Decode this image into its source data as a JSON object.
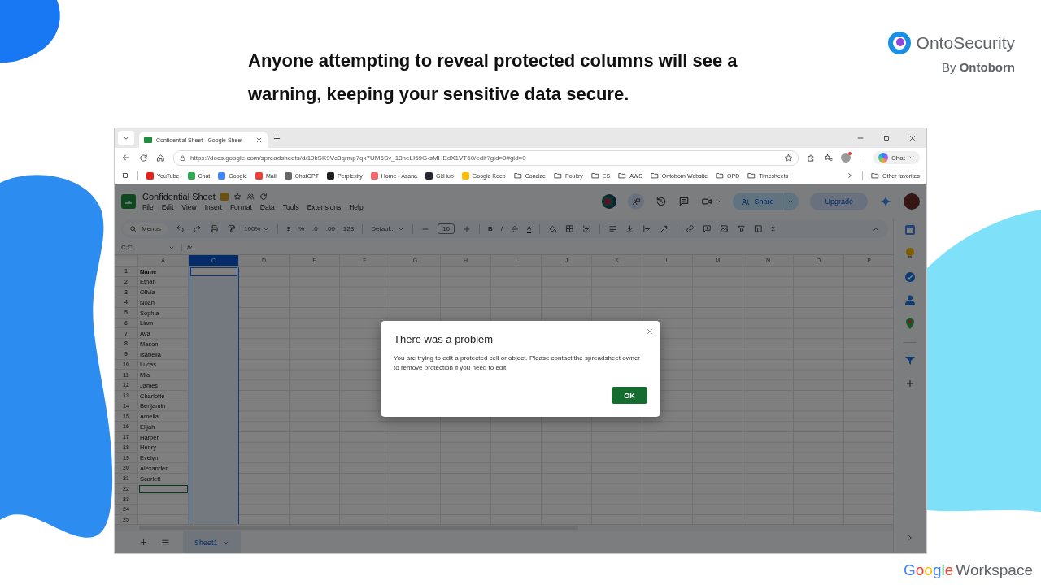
{
  "slide": {
    "heading": "Anyone attempting to reveal protected columns will see a warning, **keeping your sensitive data secure**.",
    "brand": {
      "name": "OntoSecurity",
      "byline": "By **Ontoborn**"
    },
    "footer_logo": {
      "google": "Google",
      "product": "Workspace"
    }
  },
  "browser": {
    "tabs": [
      {
        "title": "Confidential Sheet - Google Sheet",
        "selected": true
      }
    ],
    "url": "https://docs.google.com/spreadsheets/d/19kSK9Vc3qrmp7qk7UM6Sv_13heLI69G-sMHEdX1VT60/edit?gid=0#gid=0",
    "more": "···",
    "chat_button": "Chat",
    "bookmarks": [
      {
        "kind": "site",
        "label": "YouTube",
        "color": "#e62117"
      },
      {
        "kind": "site",
        "label": "Chat",
        "color": "#34a853"
      },
      {
        "kind": "site",
        "label": "Google",
        "color": "#4285f4"
      },
      {
        "kind": "site",
        "label": "Mail",
        "color": "#ea4335"
      },
      {
        "kind": "site",
        "label": "ChatGPT",
        "color": "#666666"
      },
      {
        "kind": "site",
        "label": "Perplexity",
        "color": "#1f1f1f"
      },
      {
        "kind": "site",
        "label": "Home - Asana",
        "color": "#f06a6a"
      },
      {
        "kind": "site",
        "label": "GitHub",
        "color": "#24292f"
      },
      {
        "kind": "site",
        "label": "Google Keep",
        "color": "#fbbc04"
      },
      {
        "kind": "folder",
        "label": "Concize"
      },
      {
        "kind": "folder",
        "label": "Poultry"
      },
      {
        "kind": "folder",
        "label": "ES"
      },
      {
        "kind": "folder",
        "label": "AWS"
      },
      {
        "kind": "folder",
        "label": "Ontoborn Website"
      },
      {
        "kind": "folder",
        "label": "OPD"
      },
      {
        "kind": "folder",
        "label": "Timesheets"
      }
    ],
    "other_favorites": "Other favorites"
  },
  "sheets": {
    "title": "Confidential Sheet",
    "menu": [
      "File",
      "Edit",
      "View",
      "Insert",
      "Format",
      "Data",
      "Tools",
      "Extensions",
      "Help"
    ],
    "share": "Share",
    "upgrade": "Upgrade",
    "toolbar": {
      "search_placeholder": "Menus",
      "zoom": "100%",
      "number_formats": [
        "$",
        "%",
        ".0",
        ".00",
        "123"
      ],
      "font": "Defaul...",
      "font_size": "10",
      "styles": [
        "B",
        "I"
      ],
      "text_color": "A",
      "functions": "Σ"
    },
    "name_box": "C:C",
    "formula_label": "fx",
    "columns": [
      {
        "label": "A",
        "selected": false
      },
      {
        "label": "C",
        "selected": true
      },
      {
        "label": "D",
        "selected": false
      },
      {
        "label": "E",
        "selected": false
      },
      {
        "label": "F",
        "selected": false
      },
      {
        "label": "G",
        "selected": false
      },
      {
        "label": "H",
        "selected": false
      },
      {
        "label": "I",
        "selected": false
      },
      {
        "label": "J",
        "selected": false
      },
      {
        "label": "K",
        "selected": false
      },
      {
        "label": "L",
        "selected": false
      },
      {
        "label": "M",
        "selected": false
      },
      {
        "label": "N",
        "selected": false
      },
      {
        "label": "O",
        "selected": false
      },
      {
        "label": "P",
        "selected": false
      }
    ],
    "rows": [
      {
        "number": "1",
        "value": "Name",
        "bold": true,
        "selected": false
      },
      {
        "number": "2",
        "value": "Ethan",
        "bold": false,
        "selected": false
      },
      {
        "number": "3",
        "value": "Olivia",
        "bold": false,
        "selected": false
      },
      {
        "number": "4",
        "value": "Noah",
        "bold": false,
        "selected": false
      },
      {
        "number": "5",
        "value": "Sophia",
        "bold": false,
        "selected": false
      },
      {
        "number": "6",
        "value": "Liam",
        "bold": false,
        "selected": false
      },
      {
        "number": "7",
        "value": "Ava",
        "bold": false,
        "selected": false
      },
      {
        "number": "8",
        "value": "Mason",
        "bold": false,
        "selected": false
      },
      {
        "number": "9",
        "value": "Isabella",
        "bold": false,
        "selected": false
      },
      {
        "number": "10",
        "value": "Lucas",
        "bold": false,
        "selected": false
      },
      {
        "number": "11",
        "value": "Mia",
        "bold": false,
        "selected": false
      },
      {
        "number": "12",
        "value": "James",
        "bold": false,
        "selected": false
      },
      {
        "number": "13",
        "value": "Charlotte",
        "bold": false,
        "selected": false
      },
      {
        "number": "14",
        "value": "Benjamin",
        "bold": false,
        "selected": false
      },
      {
        "number": "15",
        "value": "Amelia",
        "bold": false,
        "selected": false
      },
      {
        "number": "16",
        "value": "Elijah",
        "bold": false,
        "selected": false
      },
      {
        "number": "17",
        "value": "Harper",
        "bold": false,
        "selected": false
      },
      {
        "number": "18",
        "value": "Henry",
        "bold": false,
        "selected": false
      },
      {
        "number": "19",
        "value": "Evelyn",
        "bold": false,
        "selected": false
      },
      {
        "number": "20",
        "value": "Alexander",
        "bold": false,
        "selected": false
      },
      {
        "number": "21",
        "value": "Scarlett",
        "bold": false,
        "selected": false
      },
      {
        "number": "22",
        "selected": true
      },
      {
        "number": "23",
        "selected": false
      },
      {
        "number": "24",
        "selected": false
      },
      {
        "number": "25",
        "selected": false
      }
    ],
    "sheet_tabs": [
      {
        "label": "Sheet1",
        "selected": true
      }
    ]
  },
  "dialog": {
    "title": "There was a problem",
    "message": "You are trying to edit a protected cell or object. Please contact the spreadsheet owner to remove protection if you need to edit.",
    "button": "OK"
  }
}
